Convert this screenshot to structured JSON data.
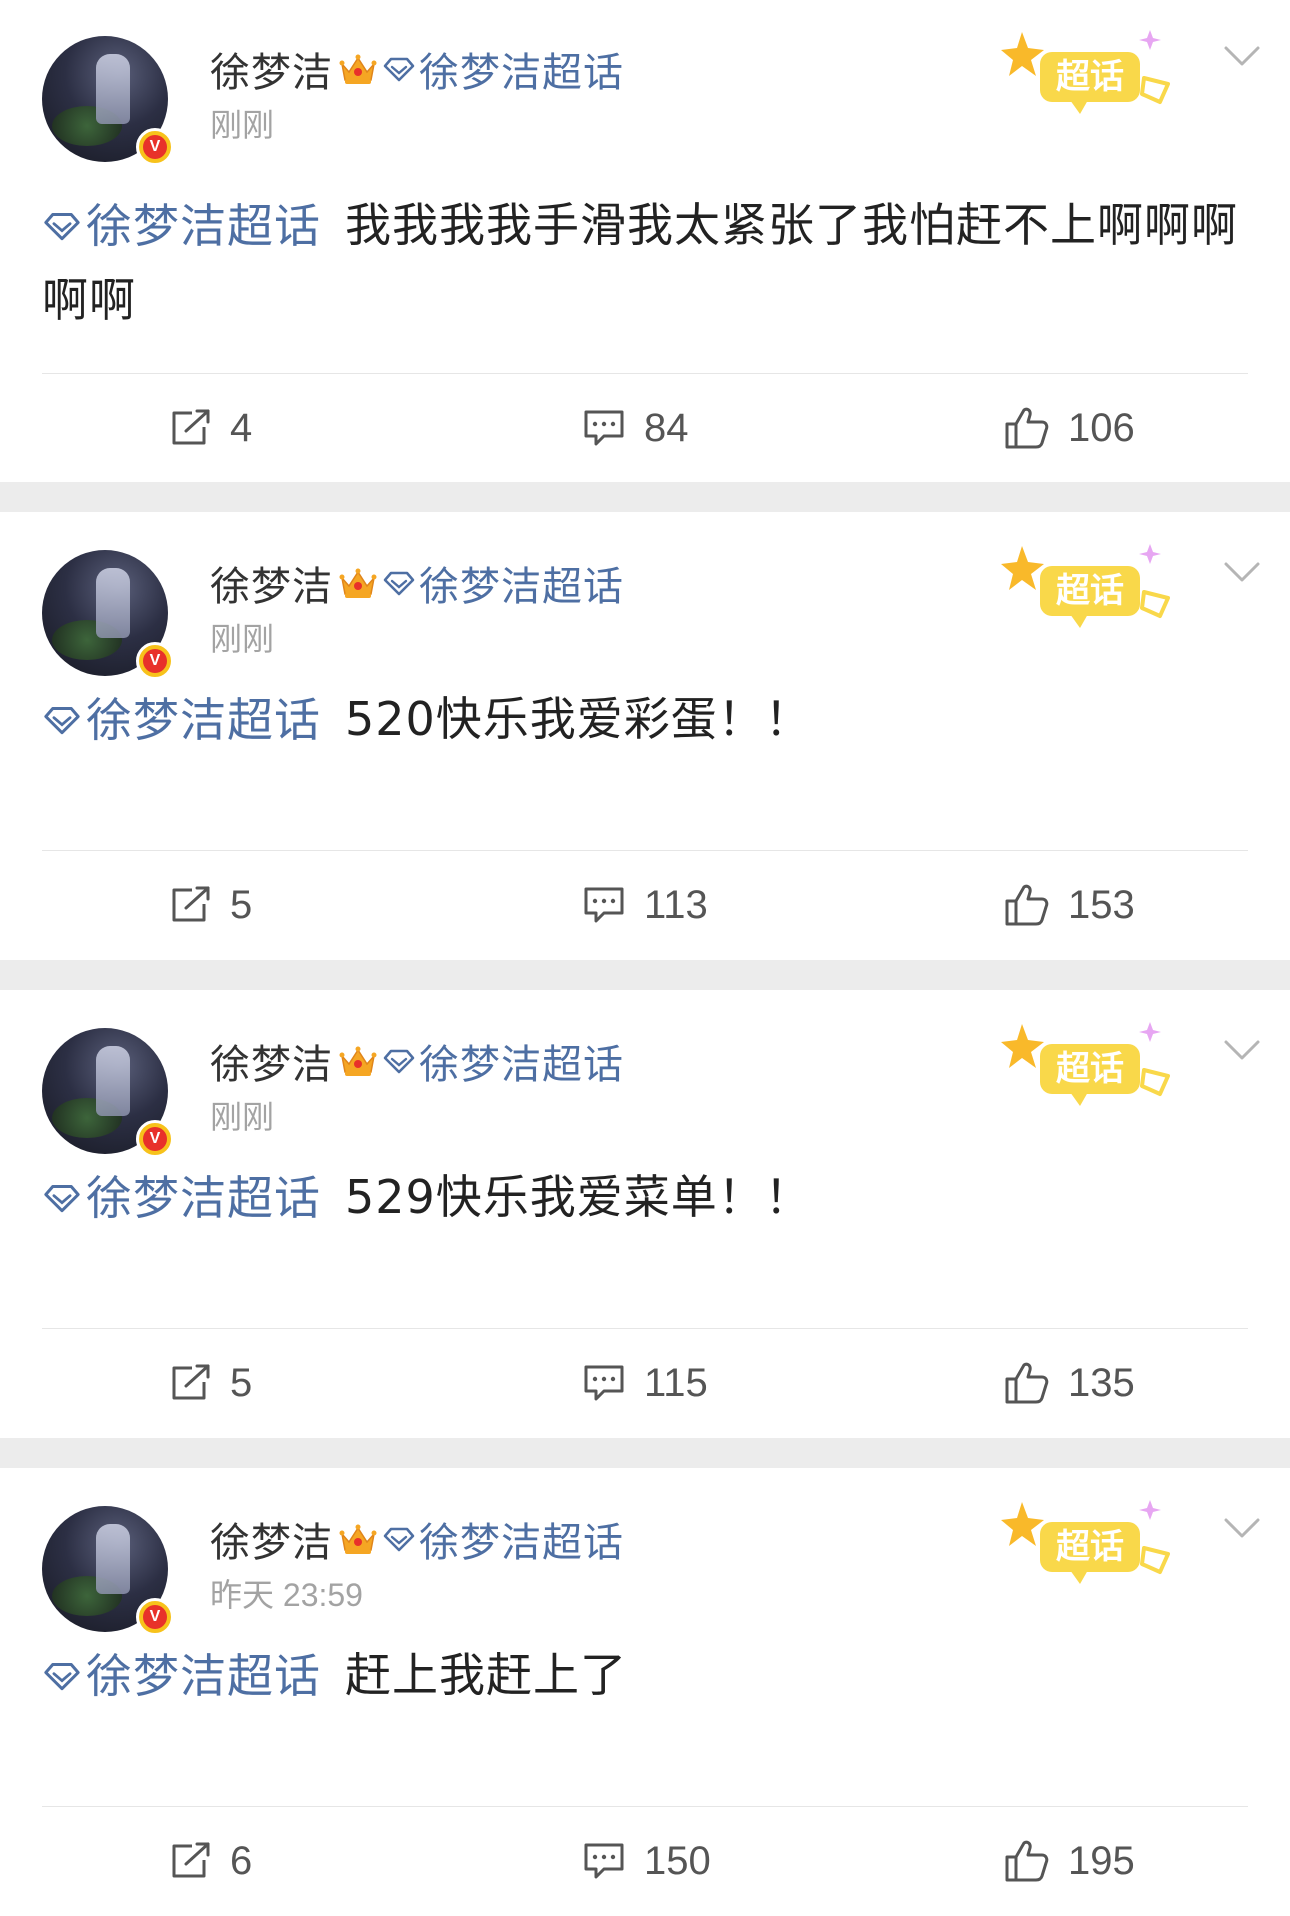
{
  "posts": [
    {
      "author": "徐梦洁",
      "topic": "徐梦洁超话",
      "time": "刚刚",
      "badge_text": "超话",
      "content_topic": "徐梦洁超话",
      "text": "我我我我手滑我太紧张了我怕赶不上啊啊啊啊啊",
      "reposts": "4",
      "comments": "84",
      "likes": "106"
    },
    {
      "author": "徐梦洁",
      "topic": "徐梦洁超话",
      "time": "刚刚",
      "badge_text": "超话",
      "content_topic": "徐梦洁超话",
      "text": "520快乐我爱彩蛋！！",
      "reposts": "5",
      "comments": "113",
      "likes": "153"
    },
    {
      "author": "徐梦洁",
      "topic": "徐梦洁超话",
      "time": "刚刚",
      "badge_text": "超话",
      "content_topic": "徐梦洁超话",
      "text": "529快乐我爱菜单！！",
      "reposts": "5",
      "comments": "115",
      "likes": "135"
    },
    {
      "author": "徐梦洁",
      "topic": "徐梦洁超话",
      "time": "昨天 23:59",
      "badge_text": "超话",
      "content_topic": "徐梦洁超话",
      "text": "赶上我赶上了",
      "reposts": "6",
      "comments": "150",
      "likes": "195"
    }
  ],
  "icons": {
    "topic": "diamond-icon",
    "member": "crown-icon",
    "verified": "verified-v-icon",
    "badge": "super-topic-badge",
    "more": "chevron-down-icon",
    "repost": "repost-icon",
    "comment": "comment-icon",
    "like": "thumbs-up-icon"
  },
  "colors": {
    "link": "#4e6fa3",
    "muted": "#a3a3a3",
    "badge": "#f9d84a",
    "separator": "#ececec"
  }
}
